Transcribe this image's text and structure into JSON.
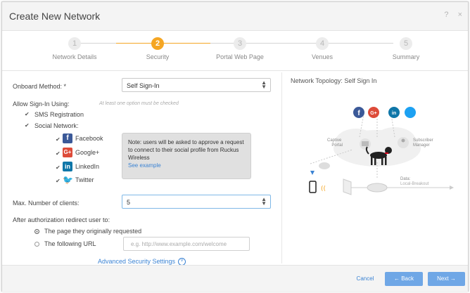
{
  "dialog": {
    "title": "Create New Network",
    "help": "?",
    "close": "×"
  },
  "steps": [
    {
      "num": "1",
      "label": "Network Details"
    },
    {
      "num": "2",
      "label": "Security"
    },
    {
      "num": "3",
      "label": "Portal Web Page"
    },
    {
      "num": "4",
      "label": "Venues"
    },
    {
      "num": "5",
      "label": "Summary"
    }
  ],
  "active_step": 2,
  "form": {
    "onboard_label": "Onboard Method: *",
    "onboard_value": "Self Sign-In",
    "allow_label": "Allow Sign-In Using:",
    "allow_hint": "At least one option must be checked",
    "sms": "SMS Registration",
    "social": "Social Network:",
    "networks": [
      "Facebook",
      "Google+",
      "LinkedIn",
      "Twitter"
    ],
    "note_text": "Note: users will be asked to approve a request to connect to their social profile from Ruckus Wireless",
    "note_link": "See example",
    "max_label": "Max. Number of clients:",
    "max_value": "5",
    "redirect_label": "After authorization redirect user to:",
    "opt_original": "The page they originally requested",
    "opt_url": "The following URL",
    "url_placeholder": "e.g. http://www.example.com/welcome",
    "advanced": "Advanced Security Settings"
  },
  "topology": {
    "title": "Network Topology: Self Sign In",
    "captive": "Captive\nPortal",
    "subscriber": "Subscriber\nManager",
    "data": "Data:",
    "breakout": "Local-Breakout"
  },
  "footer": {
    "cancel": "Cancel",
    "back": "← Back",
    "next": "Next →"
  },
  "colors": {
    "accent": "#f5a623",
    "link": "#3b83d3",
    "button": "#6fa7e6",
    "facebook": "#3b5998",
    "google": "#dd4b39",
    "linkedin": "#0e76a8",
    "twitter": "#1da1f2"
  }
}
